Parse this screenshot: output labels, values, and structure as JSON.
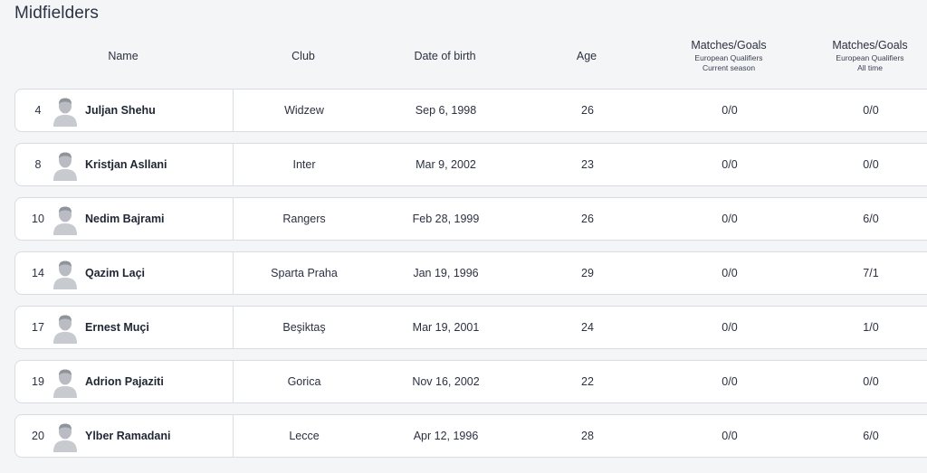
{
  "section": {
    "title": "Midfielders"
  },
  "columns": {
    "name": "Name",
    "club": "Club",
    "dob": "Date of birth",
    "age": "Age",
    "mg_current": {
      "title": "Matches/Goals",
      "line1": "European Qualifiers",
      "line2": "Current season"
    },
    "mg_alltime": {
      "title": "Matches/Goals",
      "line1": "European Qualifiers",
      "line2": "All time"
    }
  },
  "players": [
    {
      "number": "4",
      "name": "Juljan Shehu",
      "club": "Widzew",
      "dob": "Sep 6, 1998",
      "age": "26",
      "mg_current": "0/0",
      "mg_alltime": "0/0"
    },
    {
      "number": "8",
      "name": "Kristjan Asllani",
      "club": "Inter",
      "dob": "Mar 9, 2002",
      "age": "23",
      "mg_current": "0/0",
      "mg_alltime": "0/0"
    },
    {
      "number": "10",
      "name": "Nedim Bajrami",
      "club": "Rangers",
      "dob": "Feb 28, 1999",
      "age": "26",
      "mg_current": "0/0",
      "mg_alltime": "6/0"
    },
    {
      "number": "14",
      "name": "Qazim Laçi",
      "club": "Sparta Praha",
      "dob": "Jan 19, 1996",
      "age": "29",
      "mg_current": "0/0",
      "mg_alltime": "7/1"
    },
    {
      "number": "17",
      "name": "Ernest Muçi",
      "club": "Beşiktaş",
      "dob": "Mar 19, 2001",
      "age": "24",
      "mg_current": "0/0",
      "mg_alltime": "1/0"
    },
    {
      "number": "19",
      "name": "Adrion Pajaziti",
      "club": "Gorica",
      "dob": "Nov 16, 2002",
      "age": "22",
      "mg_current": "0/0",
      "mg_alltime": "0/0"
    },
    {
      "number": "20",
      "name": "Ylber Ramadani",
      "club": "Lecce",
      "dob": "Apr 12, 1996",
      "age": "28",
      "mg_current": "0/0",
      "mg_alltime": "6/0"
    }
  ]
}
